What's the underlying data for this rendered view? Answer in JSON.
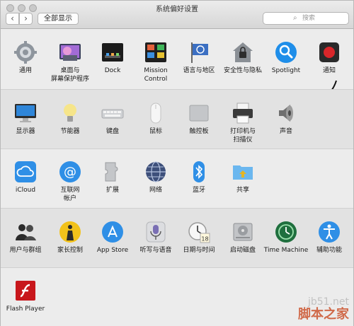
{
  "window": {
    "title": "系统偏好设置"
  },
  "toolbar": {
    "back": "‹",
    "forward": "›",
    "show_all": "全部显示",
    "search_placeholder": "搜索"
  },
  "panes": {
    "general": "通用",
    "desktop": "桌面与\n屏幕保护程序",
    "dock": "Dock",
    "mission_control": "Mission\nControl",
    "language": "语言与地区",
    "security": "安全性与隐私",
    "spotlight": "Spotlight",
    "notifications": "通知",
    "displays": "显示器",
    "energy": "节能器",
    "keyboard": "键盘",
    "mouse": "鼠标",
    "trackpad": "触控板",
    "printers": "打印机与\n扫描仪",
    "sound": "声音",
    "icloud": "iCloud",
    "internet_accounts": "互联网\n帐户",
    "extensions": "扩展",
    "network": "网络",
    "bluetooth": "蓝牙",
    "sharing": "共享",
    "users": "用户与群组",
    "parental": "家长控制",
    "app_store": "App Store",
    "dictation": "听写与语音",
    "date_time": "日期与时间",
    "startup_disk": "启动磁盘",
    "time_machine": "Time Machine",
    "accessibility": "辅助功能",
    "flash": "Flash Player"
  },
  "calendar_badge": "18",
  "watermark": {
    "url": "jb51.net",
    "name": "脚本之家"
  },
  "colors": {
    "accent_blue": "#1f8ee9",
    "notification_red": "#d9262a",
    "flash_red": "#c8171c"
  }
}
